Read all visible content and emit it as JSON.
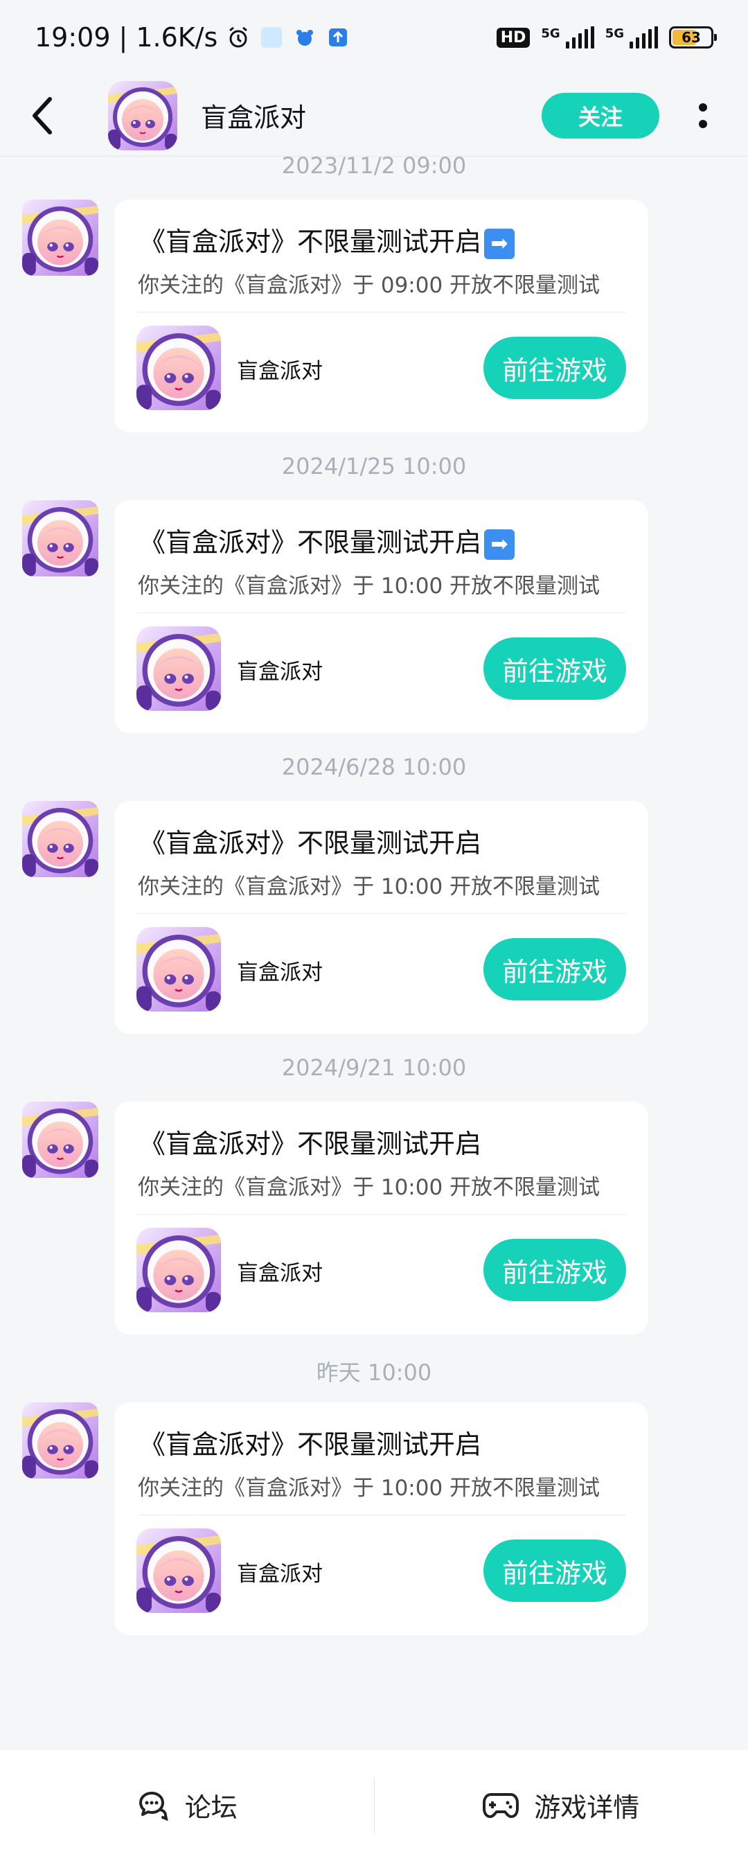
{
  "status_bar": {
    "time": "19:09",
    "speed": "1.6K/s",
    "hd_label": "HD",
    "net1": "5G",
    "net2": "5G",
    "battery": "63",
    "battery_level": 0.63
  },
  "header": {
    "title": "盲盒派对",
    "follow_label": "关注"
  },
  "messages": [
    {
      "timestamp": "2023/11/2  09:00",
      "title": "《盲盒派对》不限量测试开启",
      "title_emoji": "➡",
      "subtitle": "你关注的《盲盒派对》于 09:00 开放不限量测试",
      "game_name": "盲盒派对",
      "button_label": "前往游戏"
    },
    {
      "timestamp": "2024/1/25  10:00",
      "title": "《盲盒派对》不限量测试开启",
      "title_emoji": "➡",
      "subtitle": "你关注的《盲盒派对》于 10:00 开放不限量测试",
      "game_name": "盲盒派对",
      "button_label": "前往游戏"
    },
    {
      "timestamp": "2024/6/28  10:00",
      "title": "《盲盒派对》不限量测试开启",
      "title_emoji": "",
      "subtitle": "你关注的《盲盒派对》于 10:00 开放不限量测试",
      "game_name": "盲盒派对",
      "button_label": "前往游戏"
    },
    {
      "timestamp": "2024/9/21  10:00",
      "title": "《盲盒派对》不限量测试开启",
      "title_emoji": "",
      "subtitle": "你关注的《盲盒派对》于 10:00 开放不限量测试",
      "game_name": "盲盒派对",
      "button_label": "前往游戏"
    },
    {
      "timestamp": "昨天  10:00",
      "title": "《盲盒派对》不限量测试开启",
      "title_emoji": "",
      "subtitle": "你关注的《盲盒派对》于 10:00 开放不限量测试",
      "game_name": "盲盒派对",
      "button_label": "前往游戏"
    }
  ],
  "bottom_bar": {
    "forum_label": "论坛",
    "details_label": "游戏详情"
  },
  "colors": {
    "accent": "#16d2b9",
    "background": "#f5f6f8",
    "card": "#ffffff",
    "timestamp": "#aab0b8"
  },
  "icons": {
    "back": "chevron-left-icon",
    "more": "vertical-dots-icon",
    "forum": "chat-bubble-icon",
    "details": "gamepad-icon"
  }
}
